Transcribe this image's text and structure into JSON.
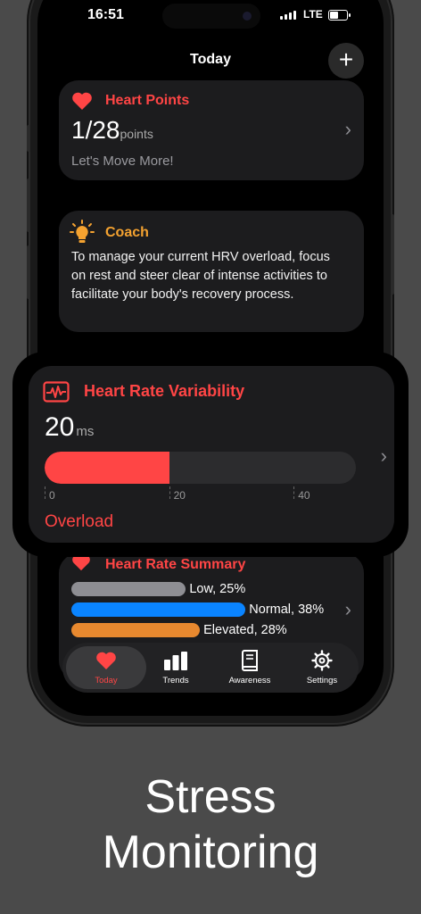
{
  "status_bar": {
    "time": "16:51",
    "network": "LTE"
  },
  "nav": {
    "title": "Today",
    "add_symbol": "+"
  },
  "heart_points": {
    "title": "Heart Points",
    "value": "1/28",
    "unit": "points",
    "subtitle": "Let's Move More!",
    "icon": "heart-icon"
  },
  "coach": {
    "title": "Coach",
    "text": "To manage your current HRV overload, focus on rest and steer clear of intense activities to facilitate your body's recovery process.",
    "icon": "lightbulb-icon"
  },
  "hrv": {
    "title": "Heart Rate Variability",
    "value": "20",
    "unit": "ms",
    "gauge_value": 20,
    "gauge_max": 50,
    "ticks": [
      "0",
      "20",
      "40"
    ],
    "status": "Overload",
    "icon": "heart-rate-monitor-icon"
  },
  "hr_summary": {
    "title": "Heart Rate Summary",
    "rows": [
      {
        "label": "Low, 25%",
        "percent": 25,
        "color": "#8e8e93"
      },
      {
        "label": "Normal, 38%",
        "percent": 38,
        "color": "#0a84ff"
      },
      {
        "label": "Elevated, 28%",
        "percent": 28,
        "color": "#e8892f"
      }
    ]
  },
  "tabs": [
    {
      "label": "Today",
      "icon": "heart-icon",
      "active": true
    },
    {
      "label": "Trends",
      "icon": "bar-chart-icon",
      "active": false
    },
    {
      "label": "Awareness",
      "icon": "book-icon",
      "active": false
    },
    {
      "label": "Settings",
      "icon": "gear-icon",
      "active": false
    }
  ],
  "caption": {
    "line1": "Stress",
    "line2": "Monitoring"
  },
  "colors": {
    "accent_red": "#ff4545",
    "coach_orange": "#f4a230",
    "card": "#1c1c1e"
  }
}
